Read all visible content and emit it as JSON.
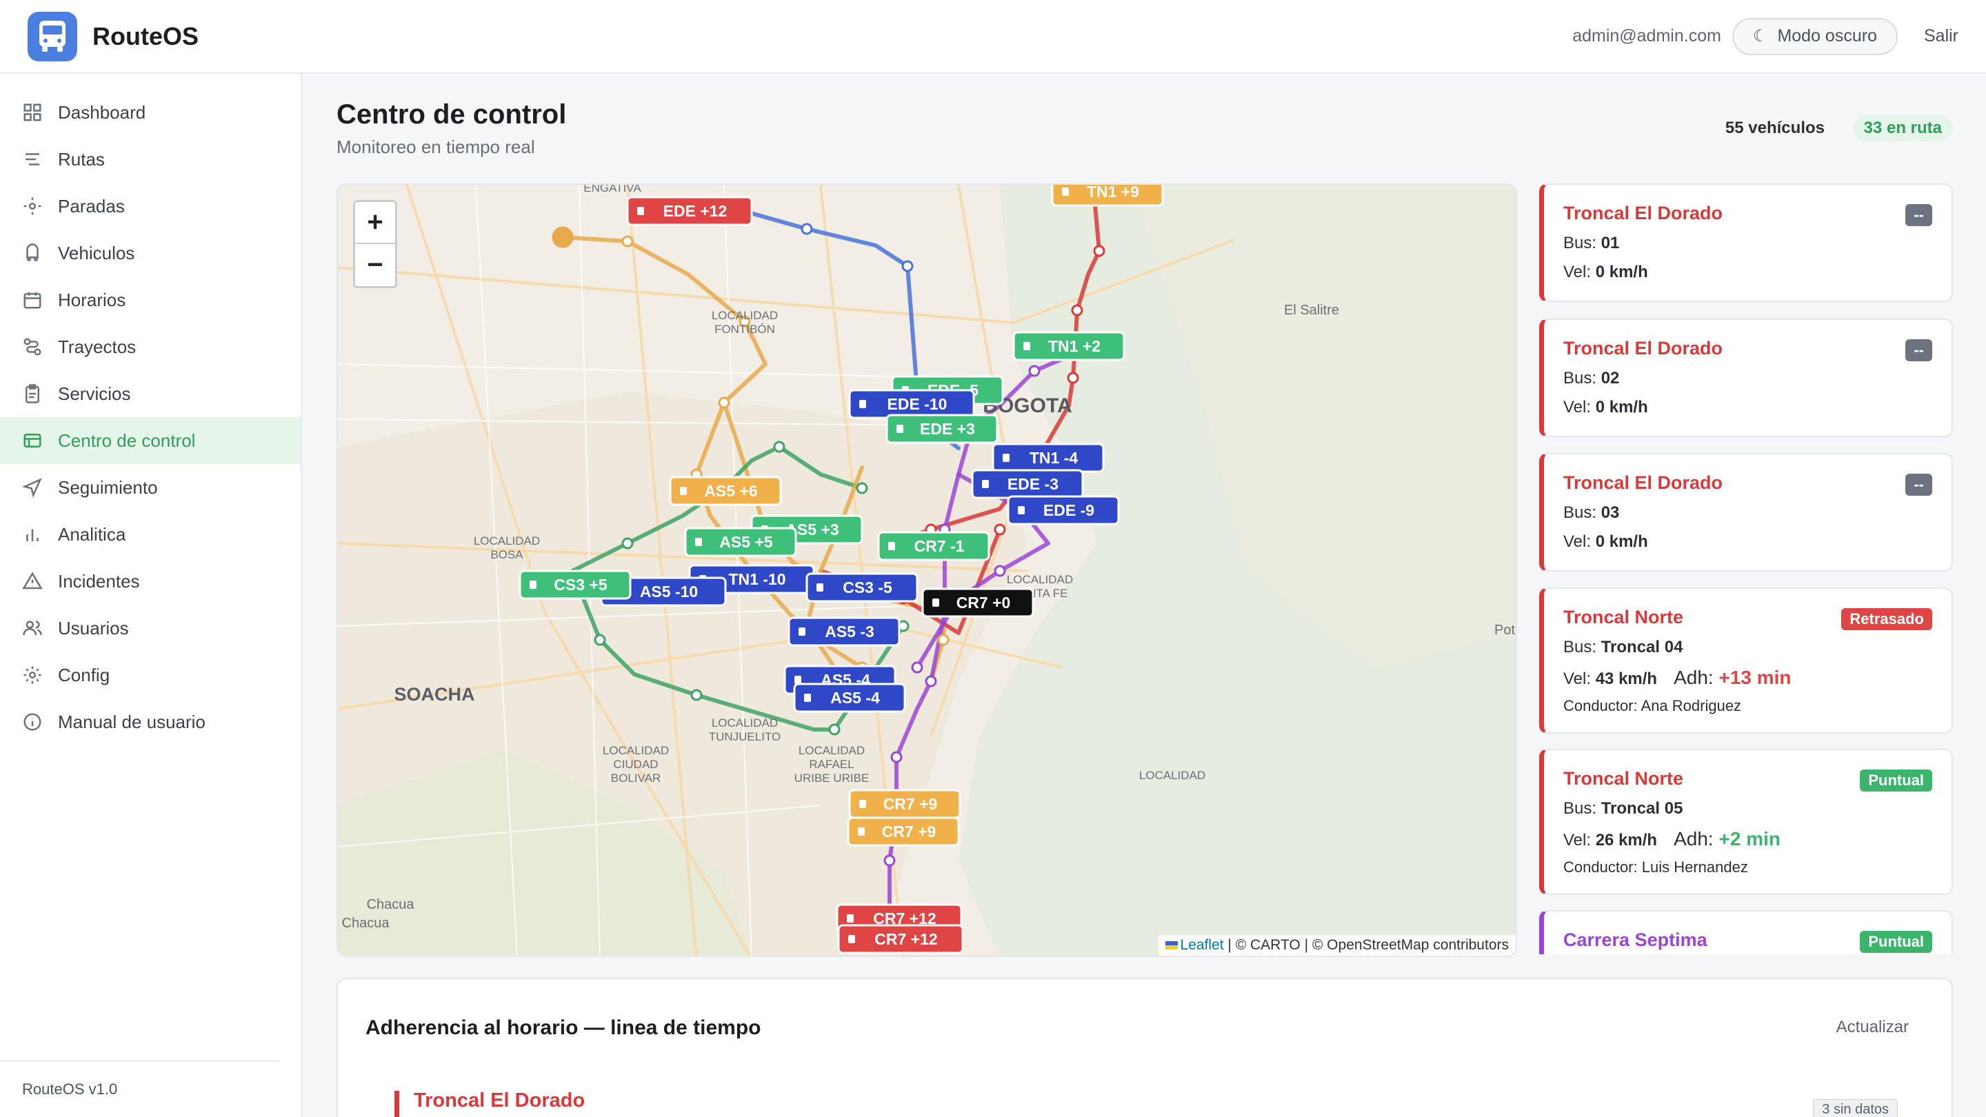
{
  "app": {
    "name": "RouteOS",
    "version": "RouteOS v1.0"
  },
  "header": {
    "user_email": "admin@admin.com",
    "dark_mode_label": "Modo oscuro",
    "logout_label": "Salir"
  },
  "sidebar": {
    "items": [
      {
        "label": "Dashboard",
        "icon": "grid-icon"
      },
      {
        "label": "Rutas",
        "icon": "routes-icon"
      },
      {
        "label": "Paradas",
        "icon": "stop-icon"
      },
      {
        "label": "Vehiculos",
        "icon": "vehicle-icon"
      },
      {
        "label": "Horarios",
        "icon": "calendar-icon"
      },
      {
        "label": "Trayectos",
        "icon": "path-icon"
      },
      {
        "label": "Servicios",
        "icon": "clipboard-icon"
      },
      {
        "label": "Centro de control",
        "icon": "control-icon",
        "active": true
      },
      {
        "label": "Seguimiento",
        "icon": "navigation-icon"
      },
      {
        "label": "Analitica",
        "icon": "chart-icon"
      },
      {
        "label": "Incidentes",
        "icon": "warning-icon"
      },
      {
        "label": "Usuarios",
        "icon": "users-icon"
      },
      {
        "label": "Config",
        "icon": "gear-icon"
      },
      {
        "label": "Manual de usuario",
        "icon": "info-icon"
      }
    ]
  },
  "page": {
    "title": "Centro de control",
    "subtitle": "Monitoreo en tiempo real",
    "vehicles_count": "55 vehículos",
    "on_route": "33 en ruta"
  },
  "map": {
    "zoom_in": "+",
    "zoom_out": "−",
    "attribution_leaflet": "Leaflet",
    "attribution_rest": " | © CARTO | © OpenStreetMap contributors",
    "places": [
      "ENGATIVA",
      "LOCALIDAD FONTIBÓN",
      "El Salitre",
      "BOGOTA",
      "LOCALIDAD BOSA",
      "SOACHA",
      "LOCALIDAD SANTA FE",
      "LOCALIDAD TUNJUELITO",
      "LOCALIDAD CIUDAD BOLIVAR",
      "LOCALIDAD RAFAEL URIBE URIBE",
      "Chacua",
      "Chacua",
      "Pot"
    ],
    "markers": [
      "EDE +12",
      "TN1 +9",
      "TN1 +2",
      "EDE -5",
      "EDE -10",
      "EDE +3",
      "TN1 -4",
      "EDE -3",
      "EDE -9",
      "AS5 +6",
      "AS5 +3",
      "AS5 +5",
      "CR7 -1",
      "TN1 -10",
      "AS5 -10",
      "CS3 +5",
      "CS3 -5",
      "CR7 +0",
      "AS5 -3",
      "AS5 -4",
      "AS5 -4",
      "CR7 +9",
      "CR7 +9",
      "CR7 +12",
      "CR7 +12"
    ]
  },
  "vehicle_cards": [
    {
      "route": "Troncal El Dorado",
      "bus": "01",
      "speed": "0 km/h",
      "status": "--",
      "status_color": "#6b7280",
      "route_color": "#d83a3a"
    },
    {
      "route": "Troncal El Dorado",
      "bus": "02",
      "speed": "0 km/h",
      "status": "--",
      "status_color": "#6b7280",
      "route_color": "#d83a3a"
    },
    {
      "route": "Troncal El Dorado",
      "bus": "03",
      "speed": "0 km/h",
      "status": "--",
      "status_color": "#6b7280",
      "route_color": "#d83a3a"
    },
    {
      "route": "Troncal Norte",
      "bus": "Troncal 04",
      "speed": "43 km/h",
      "adh": "+13 min",
      "driver": "Ana Rodriguez",
      "status": "Retrasado",
      "status_color": "#e04545",
      "route_color": "#d83a3a"
    },
    {
      "route": "Troncal Norte",
      "bus": "Troncal 05",
      "speed": "26 km/h",
      "adh": "+2 min",
      "driver": "Luis Hernandez",
      "status": "Puntual",
      "status_color": "#3bb56b",
      "route_color": "#d83a3a"
    },
    {
      "route": "Carrera Septima",
      "status": "Puntual",
      "status_color": "#3bb56b",
      "route_color": "#9b45d6"
    }
  ],
  "labels": {
    "bus": "Bus: ",
    "vel": "Vel: ",
    "adh": "Adh: ",
    "driver": "Conductor: "
  },
  "timeline": {
    "title": "Adherencia al horario — linea de tiempo",
    "refresh_label": "Actualizar",
    "first_route": "Troncal El Dorado",
    "no_data": "3 sin datos"
  }
}
